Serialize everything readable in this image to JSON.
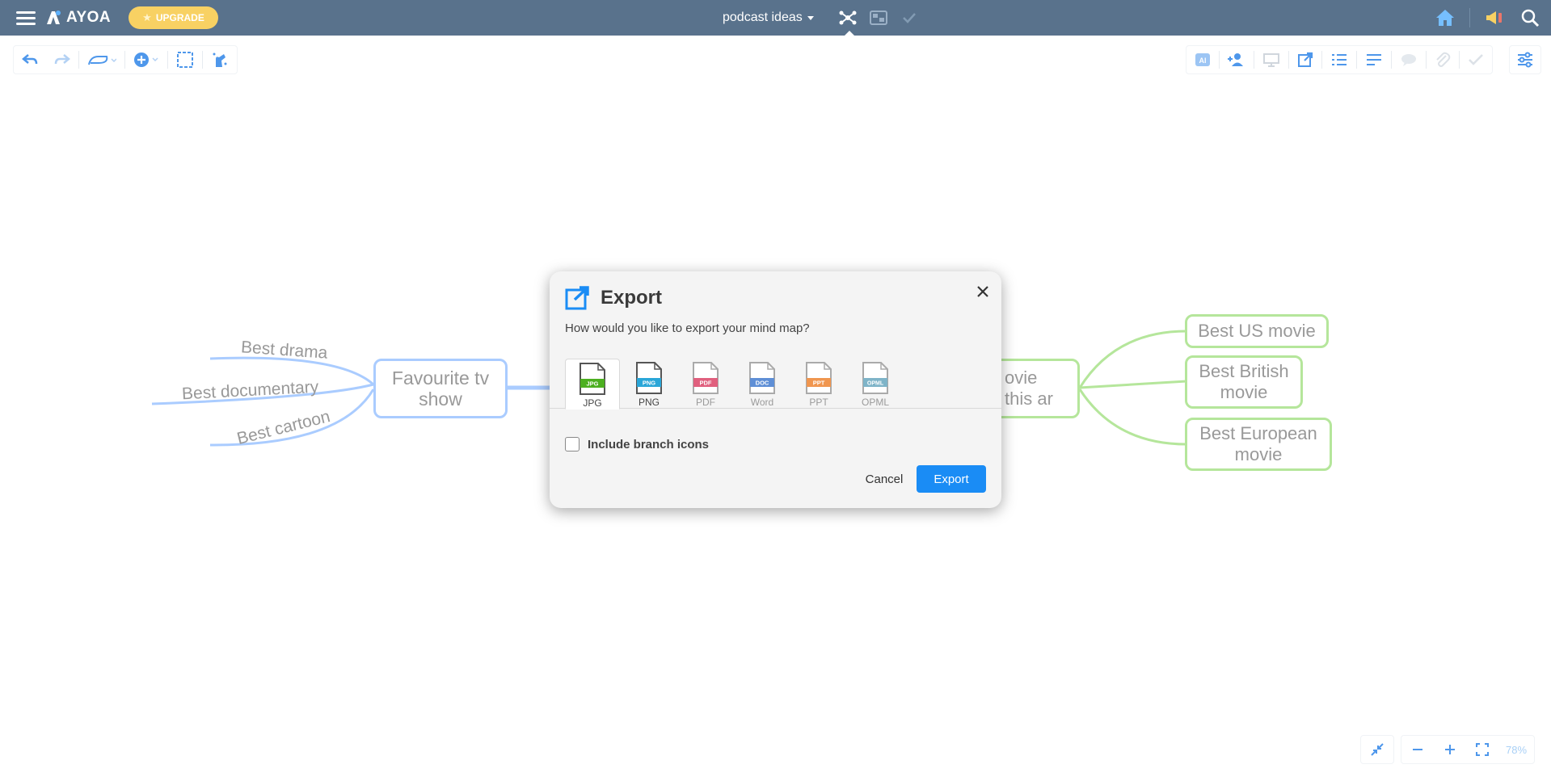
{
  "navbar": {
    "app_name": "AYOA",
    "upgrade_label": "UPGRADE",
    "map_title": "podcast ideas"
  },
  "colors": {
    "navbar_bg": "#3c5a78",
    "accent_blue": "#1a8cf5",
    "upgrade_yellow": "#f7c948",
    "branch_blue": "#9cc4ff",
    "branch_green": "#a8e28a"
  },
  "mindmap": {
    "left_branches": [
      "Best drama",
      "Best documentary",
      "Best cartoon"
    ],
    "left_node": "Favourite tv show",
    "right_node": "ovie this ar",
    "right_branches": [
      "Best US movie",
      "Best British movie",
      "Best European movie"
    ]
  },
  "dialog": {
    "title": "Export",
    "subtitle": "How would you like to export your mind map?",
    "formats": [
      {
        "tag": "JPG",
        "label": "JPG",
        "color": "#4caf20",
        "active": true
      },
      {
        "tag": "PNG",
        "label": "PNG",
        "color": "#2aa6d8",
        "active": false
      },
      {
        "tag": "PDF",
        "label": "PDF",
        "color": "#e0607e",
        "active": false
      },
      {
        "tag": "DOC",
        "label": "Word",
        "color": "#5f8fd6",
        "active": false
      },
      {
        "tag": "PPT",
        "label": "PPT",
        "color": "#f0964f",
        "active": false
      },
      {
        "tag": "OPML",
        "label": "OPML",
        "color": "#7fb4c8",
        "active": false
      }
    ],
    "checkbox_label": "Include branch icons",
    "cancel_label": "Cancel",
    "export_label": "Export"
  },
  "zoom": {
    "level": "78%"
  }
}
